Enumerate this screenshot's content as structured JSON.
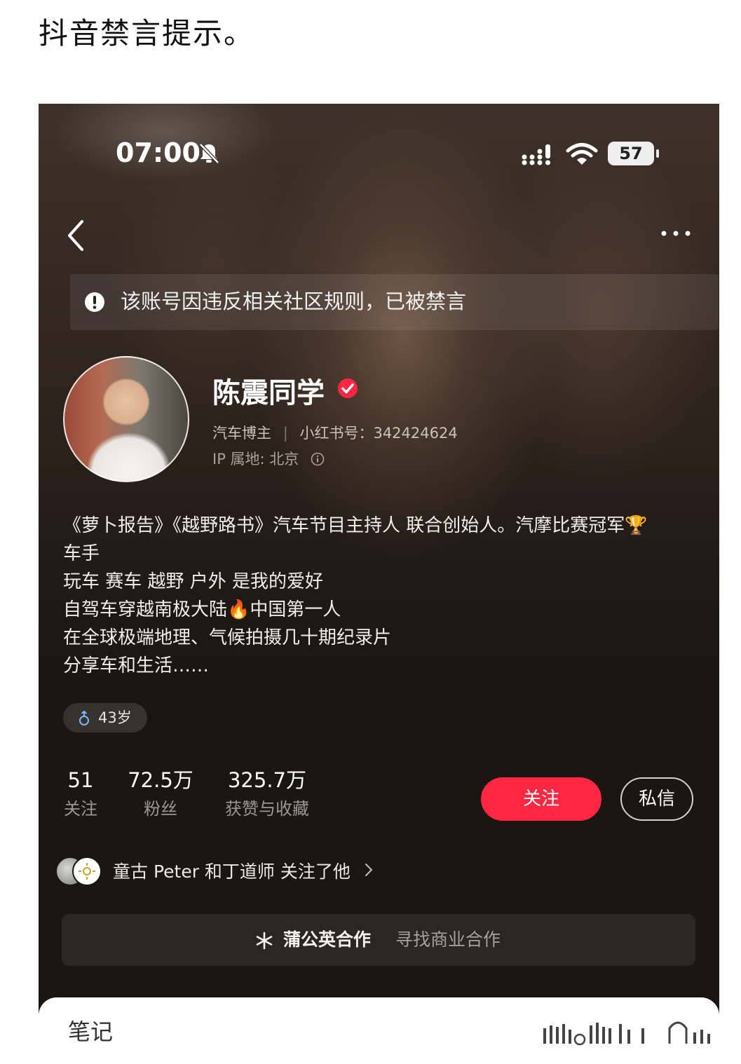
{
  "post": {
    "heading": "抖音禁言提示。"
  },
  "status_bar": {
    "time": "07:00",
    "battery": "57"
  },
  "notice": {
    "text": "该账号因违反相关社区规则，已被禁言"
  },
  "profile": {
    "name": "陈震同学",
    "role": "汽车博主",
    "id_label": "小红书号：342424624",
    "ip": "IP 属地: 北京",
    "bio": [
      "《萝卜报告》《越野路书》汽车节目主持人 联合创始人。汽摩比赛冠军🏆",
      "车手",
      "玩车 赛车 越野 户外 是我的爱好",
      "自驾车穿越南极大陆🔥中国第一人",
      "在全球极端地理、气候拍摄几十期纪录片",
      "分享车和生活……"
    ],
    "age_tag": "43岁"
  },
  "stats": [
    {
      "value": "51",
      "label": "关注"
    },
    {
      "value": "72.5万",
      "label": "粉丝"
    },
    {
      "value": "325.7万",
      "label": "获赞与收藏"
    }
  ],
  "actions": {
    "follow": "关注",
    "message": "私信"
  },
  "mutual": {
    "text": "童古 Peter 和丁道师 关注了他"
  },
  "cooperation": {
    "title": "蒲公英合作",
    "subtitle": "寻找商业合作"
  },
  "tabs": {
    "notes": "笔记"
  },
  "colors": {
    "accent": "#ff2741",
    "background": "#1c1612"
  }
}
